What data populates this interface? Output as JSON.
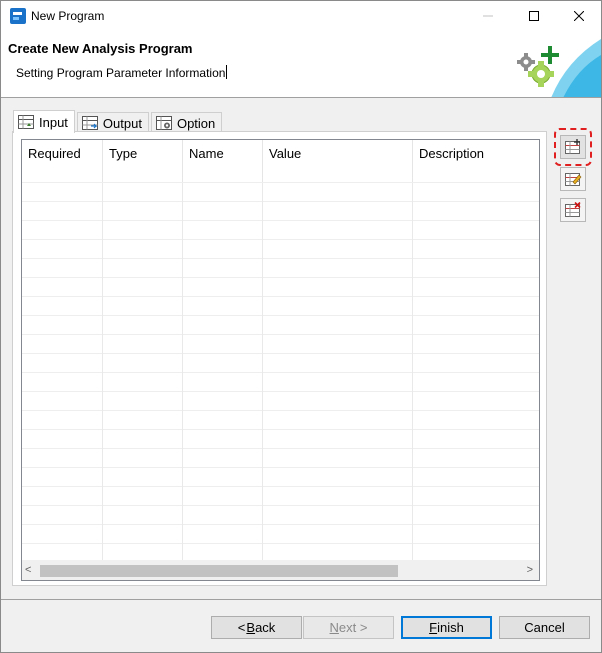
{
  "window": {
    "title": "New Program",
    "minimize_glyph": "—",
    "maximize_glyph": "☐",
    "close_glyph": "✕"
  },
  "banner": {
    "title": "Create New Analysis Program",
    "subtitle": "Setting Program Parameter Information"
  },
  "tabs": [
    {
      "label": "Input",
      "icon": "table-input-icon",
      "active": true
    },
    {
      "label": "Output",
      "icon": "table-output-icon",
      "active": false
    },
    {
      "label": "Option",
      "icon": "table-option-icon",
      "active": false
    }
  ],
  "table": {
    "columns": [
      "Required",
      "Type",
      "Name",
      "Value",
      "Description"
    ],
    "rows": []
  },
  "side_buttons": [
    {
      "icon": "add-row-icon"
    },
    {
      "icon": "edit-row-icon"
    },
    {
      "icon": "delete-row-icon"
    }
  ],
  "footer": {
    "back_prefix": "< ",
    "back_mnemonic": "B",
    "back_rest": "ack",
    "next_mnemonic": "N",
    "next_rest": "ext >",
    "finish_mnemonic": "F",
    "finish_rest": "inish",
    "cancel": "Cancel"
  },
  "colors": {
    "accent": "#0078d7",
    "plus_green": "#1e8a32",
    "focus_highlight": "#e02020"
  }
}
